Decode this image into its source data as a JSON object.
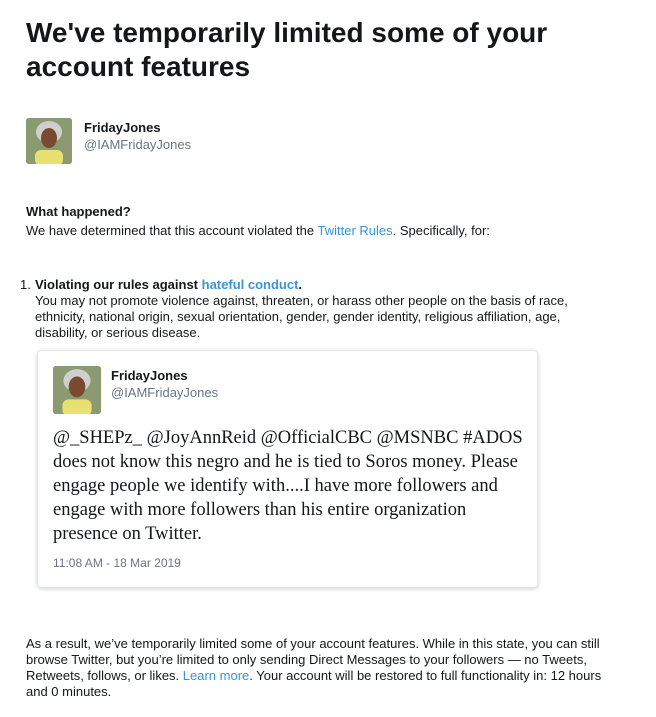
{
  "page": {
    "title": "We've temporarily limited some of your account features"
  },
  "account": {
    "display_name": "FridayJones",
    "handle": "@IAMFridayJones",
    "avatar": "profile-photo-avatar"
  },
  "what_happened": {
    "heading": "What happened?",
    "text_before": "We have determined that this account violated the ",
    "rules_link": "Twitter Rules",
    "text_after": ". Specifically, for:"
  },
  "violations": [
    {
      "number": "1.",
      "title_before": "Violating our rules against ",
      "title_link": "hateful conduct",
      "title_after": ".",
      "description": "You may not promote violence against, threaten, or harass other people on the basis of race, ethnicity, national origin, sexual orientation, gender, gender identity, religious affiliation, age, disability, or serious disease."
    }
  ],
  "tweet": {
    "display_name": "FridayJones",
    "handle": "@IAMFridayJones",
    "text": "@_SHEPz_ @JoyAnnReid @OfficialCBC @MSNBC #ADOS does not know this negro and he is tied to Soros money. Please engage people we identify with....I have more followers and engage with more followers than his entire organization presence on Twitter.",
    "timestamp": "11:08 AM - 18 Mar 2019"
  },
  "result": {
    "text_before": "As a result, we’ve temporarily limited some of your account features. While in this state, you can still browse Twitter, but you’re limited to only sending Direct Messages to your followers — no Tweets, Retweets, follows, or likes. ",
    "learn_more_link": "Learn more",
    "text_after": ". Your account will be restored to full functionality in: 12 hours and 0 minutes."
  },
  "colors": {
    "link": "#3b94d9",
    "text": "#14171a",
    "secondary_text": "#657786",
    "card_border": "#e1e8ed"
  }
}
